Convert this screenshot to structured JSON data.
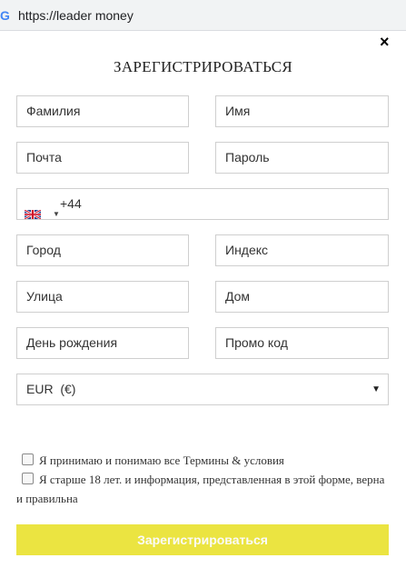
{
  "browser": {
    "url": "https://leader money"
  },
  "modal": {
    "title": "ЗАРЕГИСТРИРОВАТЬСЯ",
    "close_icon": "×",
    "fields": {
      "last_name": "Фамилия",
      "first_name": "Имя",
      "email": "Почта",
      "password": "Пароль",
      "phone_code": "+44",
      "city": "Город",
      "postcode": "Индекс",
      "street": "Улица",
      "house": "Дом",
      "birthday": "День рождения",
      "promo": "Промо код"
    },
    "phone_country_icon": "uk-flag-icon",
    "currency": {
      "selected": "EUR  (€)"
    },
    "checkboxes": {
      "terms": "Я принимаю и понимаю все Термины & условия",
      "age": "Я старше 18 лет. и информация, представленная в этой форме, верна и правильна"
    },
    "submit_label": "Зарегистрироваться",
    "colors": {
      "accent": "#ebe441",
      "border": "#cfcfcf"
    }
  }
}
